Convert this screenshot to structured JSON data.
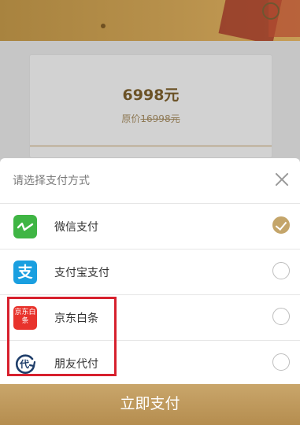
{
  "product": {
    "price": "6998元",
    "original_prefix": "原价",
    "original_price": "16998元"
  },
  "sheet": {
    "title": "请选择支付方式",
    "options": [
      {
        "label": "微信支付",
        "icon": "wechat-icon",
        "selected": true
      },
      {
        "label": "支付宝支付",
        "icon": "alipay-icon",
        "selected": false
      },
      {
        "label": "京东白条",
        "icon": "jd-baitiao-icon",
        "icon_text": "京东白条",
        "selected": false
      },
      {
        "label": "朋友代付",
        "icon": "friend-pay-icon",
        "icon_text": "代",
        "selected": false
      }
    ]
  },
  "pay_button": {
    "label": "立即支付"
  },
  "colors": {
    "accent": "#c4a56a",
    "highlight_frame": "#d7202d"
  }
}
